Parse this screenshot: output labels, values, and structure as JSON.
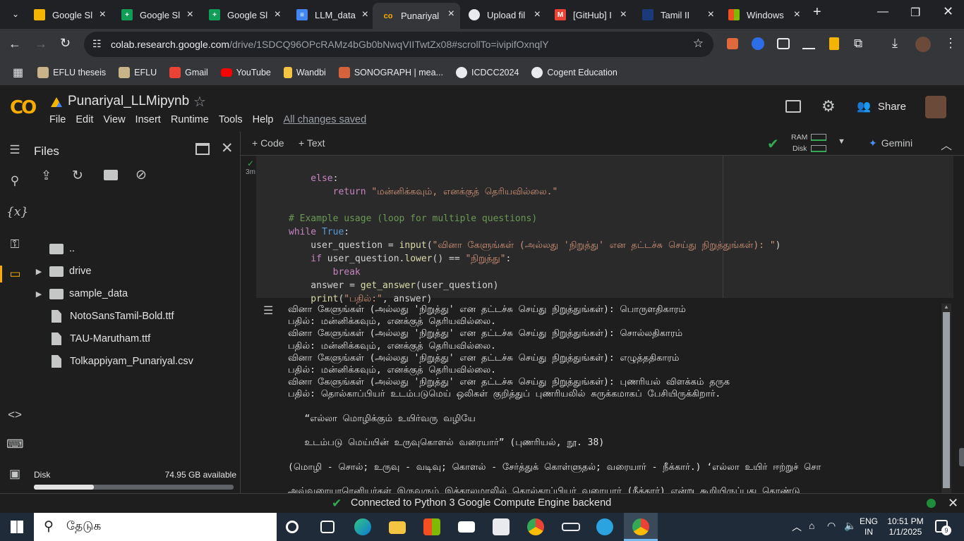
{
  "tabs": [
    {
      "title": "Google Sl",
      "icon": "google-slides-icon"
    },
    {
      "title": "Google Sl",
      "icon": "google-sheets-icon"
    },
    {
      "title": "Google Sl",
      "icon": "google-sheets-icon"
    },
    {
      "title": "LLM_data",
      "icon": "google-docs-icon"
    },
    {
      "title": "Punariyal",
      "icon": "colab-icon"
    },
    {
      "title": "Upload fil",
      "icon": "github-icon"
    },
    {
      "title": "[GitHub] I",
      "icon": "gmail-icon"
    },
    {
      "title": "Tamil II",
      "icon": "tamil-site-icon"
    },
    {
      "title": "Windows",
      "icon": "windows-icon"
    }
  ],
  "address": {
    "host": "colab.research.google.com",
    "path": "/drive/1SDCQ96OPcRAMz4bGb0bNwqVIITwtZx08#scrollTo=ivipifOxnqlY"
  },
  "bookmarks": [
    "EFLU theseis",
    "EFLU",
    "Gmail",
    "YouTube",
    "Wandbi",
    "SONOGRAPH | mea...",
    "ICDCC2024",
    "Cogent Education"
  ],
  "notebook": {
    "title": "Punariyal_LLMipynb",
    "share": "Share"
  },
  "menus": [
    "File",
    "Edit",
    "View",
    "Insert",
    "Runtime",
    "Tools",
    "Help"
  ],
  "saved_status": "All changes saved",
  "files_panel": {
    "title": "Files",
    "items": [
      "..",
      "drive",
      "sample_data",
      "NotoSansTamil-Bold.ttf",
      "TAU-Marutham.ttf",
      "Tolkappiyam_Punariyal.csv"
    ],
    "disk_label": "Disk",
    "disk_available": "74.95 GB available",
    "disk_used_fraction": 0.3
  },
  "toolbar": {
    "code": "+ Code",
    "text": "+ Text",
    "ram": "RAM",
    "disk": "Disk",
    "gemini": "Gemini"
  },
  "cell": {
    "exec_time": "3m"
  },
  "code_lines": [
    "    else:",
    "        return \"மன்னிக்கவும், எனக்குத் தெரியவில்லை.\"",
    "",
    "# Example usage (loop for multiple questions)",
    "while True:",
    "    user_question = input(\"வினா கேளுங்கள் (அல்லது 'நிறுத்து' என தட்டச்சு செய்து நிறுத்துங்கள்): \")",
    "    if user_question.lower() == \"நிறுத்து\":",
    "        break",
    "    answer = get_answer(user_question)",
    "    print(\"பதில்:\", answer)"
  ],
  "output_lines": [
    "வினா கேளுங்கள் (அல்லது 'நிறுத்து' என தட்டச்சு செய்து நிறுத்துங்கள்): பொருளதிகாரம்",
    "பதில்: மன்னிக்கவும், எனக்குத் தெரியவில்லை.",
    "வினா கேளுங்கள் (அல்லது 'நிறுத்து' என தட்டச்சு செய்து நிறுத்துங்கள்): சொல்லதிகாரம்",
    "பதில்: மன்னிக்கவும், எனக்குத் தெரியவில்லை.",
    "வினா கேளுங்கள் (அல்லது 'நிறுத்து' என தட்டச்சு செய்து நிறுத்துங்கள்): எழுத்ததிகாரம்",
    "பதில்: மன்னிக்கவும், எனக்குத் தெரியவில்லை.",
    "வினா கேளுங்கள் (அல்லது 'நிறுத்து' என தட்டச்சு செய்து நிறுத்துங்கள்): புணரியல் விளக்கம் தருக",
    "பதில்: தொல்காப்பியர் உடம்படுமெய் ஒலிகள் குறித்துப் புணரியலில் சுருக்கமாகப் பேசியிருக்கிறார்.",
    "",
    "   “எல்லா மொழிக்கும் உயிர்வரு வழியே",
    "",
    "   உடம்படு மெய்யின் உருவுகொளல் வரையார்” (புணரியல், நூ. 38)",
    "",
    "(மொழி - சொல்; உருவு - வடிவு; கொளல் - சேர்த்துக் கொள்ளுதல்; வரையார் - நீக்கார்.) ‘எல்லா உயிர் ஈற்றுச் சொ",
    "",
    "அவ்வரையாரெனியர்கள் இருவரும் இக்காலமாலில் தொல்காப்பியர் வரையார் (நீக்கார்) என்று கூறியிருப்பது தொண்டு"
  ],
  "status": {
    "message": "Connected to Python 3 Google Compute Engine backend"
  },
  "taskbar": {
    "search": "தேடுக",
    "lang1": "ENG",
    "lang2": "IN",
    "time": "10:51 PM",
    "date": "1/1/2025",
    "badge": "9"
  },
  "colors": {
    "accent": "#f9ab00",
    "bg": "#1e1e1e",
    "green": "#34a853"
  }
}
